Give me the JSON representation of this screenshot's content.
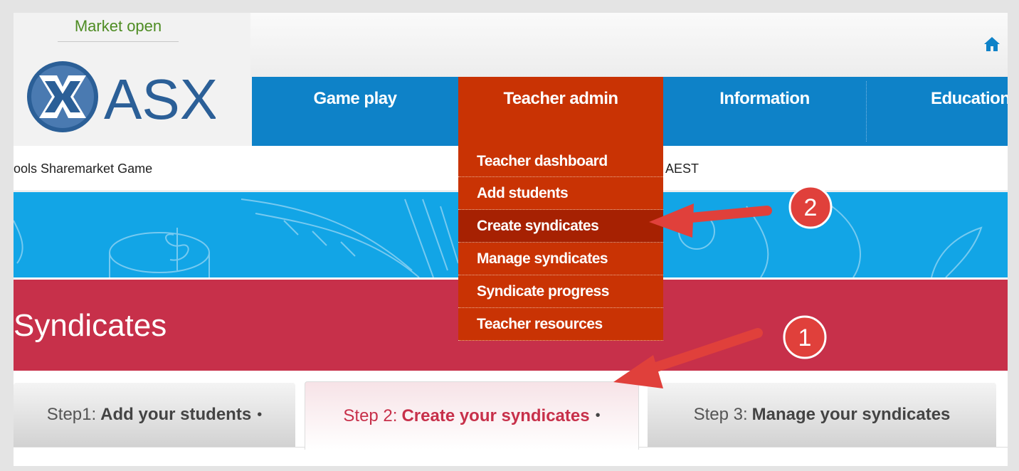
{
  "market_status": "Market open",
  "logo": {
    "text": "ASX"
  },
  "nav": {
    "items": [
      "Game play",
      "Teacher admin",
      "Information",
      "Education"
    ]
  },
  "site_title": "ools Sharemarket Game",
  "time_suffix": "AEST",
  "dropdown": {
    "items": [
      "Teacher dashboard",
      "Add students",
      "Create syndicates",
      "Manage syndicates",
      "Syndicate progress",
      "Teacher resources"
    ],
    "active_index": 2
  },
  "page_title": "Syndicates",
  "tabs": [
    {
      "prefix": "Step1:",
      "label": "Add your students",
      "dot": "•"
    },
    {
      "prefix": "Step 2:",
      "label": "Create your syndicates",
      "dot": "•"
    },
    {
      "prefix": "Step 3:",
      "label": "Manage your syndicates",
      "dot": ""
    }
  ],
  "callouts": [
    "1",
    "2"
  ],
  "colors": {
    "nav_blue": "#0e82c8",
    "menu_orange": "#c93304",
    "heading_red": "#c7304a",
    "banner_blue": "#12a5e6",
    "market_green": "#4e8c23",
    "arrow_red": "#e0403b"
  }
}
